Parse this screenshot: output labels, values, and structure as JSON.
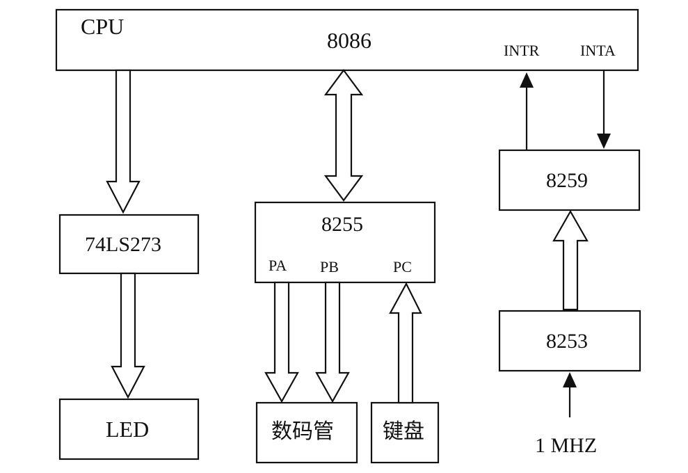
{
  "diagram": {
    "cpu": {
      "label": "CPU",
      "chip": "8086",
      "intr": "INTR",
      "inta": "INTA"
    },
    "latch": "74LS273",
    "led": "LED",
    "ppi": {
      "chip": "8255",
      "pa": "PA",
      "pb": "PB",
      "pc": "PC"
    },
    "display": "数码管",
    "keyboard": "键盘",
    "pic": "8259",
    "timer": "8253",
    "clock": "1 MHZ"
  }
}
